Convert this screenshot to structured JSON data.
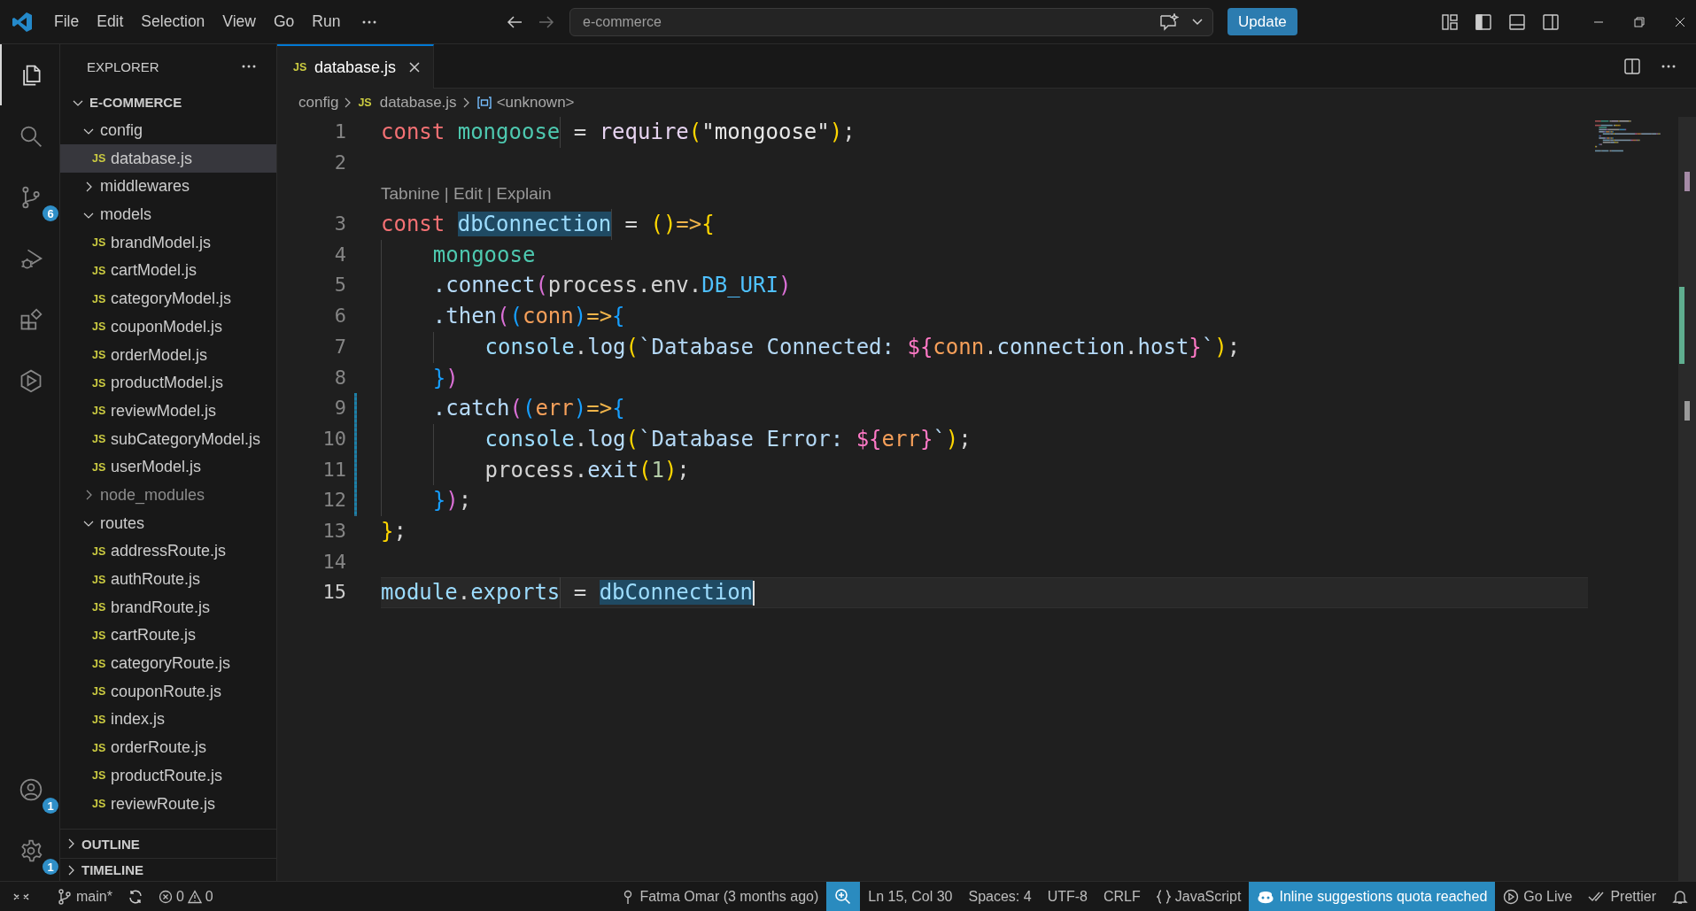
{
  "title_bar": {
    "menu": [
      "File",
      "Edit",
      "Selection",
      "View",
      "Go",
      "Run"
    ],
    "command_center": "e-commerce",
    "update_button": "Update"
  },
  "activity_bar": {
    "top": [
      {
        "kind": "files",
        "selected": true
      },
      {
        "kind": "search",
        "selected": false
      },
      {
        "kind": "source-control",
        "selected": false,
        "badge": "6"
      },
      {
        "kind": "run-debug",
        "selected": false
      },
      {
        "kind": "extensions",
        "selected": false
      },
      {
        "kind": "hexagon",
        "selected": false
      }
    ],
    "bottom": [
      {
        "kind": "accounts",
        "selected": false,
        "badge": "1"
      },
      {
        "kind": "settings",
        "selected": false,
        "badge": "1"
      }
    ]
  },
  "explorer": {
    "title": "EXPLORER",
    "tree": [
      {
        "name": "E-COMMERCE",
        "kind": "root",
        "expanded": true,
        "selected": false,
        "ignored": false,
        "children": [
          {
            "name": "config",
            "kind": "folder",
            "expanded": true,
            "selected": false,
            "ignored": false,
            "children": [
              {
                "name": "database.js",
                "kind": "file",
                "icon": "JS",
                "selected": true,
                "ignored": false
              }
            ]
          },
          {
            "name": "middlewares",
            "kind": "folder",
            "expanded": false,
            "selected": false,
            "ignored": false
          },
          {
            "name": "models",
            "kind": "folder",
            "expanded": true,
            "selected": false,
            "ignored": false,
            "children": [
              {
                "name": "brandModel.js",
                "kind": "file",
                "icon": "JS",
                "selected": false,
                "ignored": false
              },
              {
                "name": "cartModel.js",
                "kind": "file",
                "icon": "JS",
                "selected": false,
                "ignored": false
              },
              {
                "name": "categoryModel.js",
                "kind": "file",
                "icon": "JS",
                "selected": false,
                "ignored": false
              },
              {
                "name": "couponModel.js",
                "kind": "file",
                "icon": "JS",
                "selected": false,
                "ignored": false
              },
              {
                "name": "orderModel.js",
                "kind": "file",
                "icon": "JS",
                "selected": false,
                "ignored": false
              },
              {
                "name": "productModel.js",
                "kind": "file",
                "icon": "JS",
                "selected": false,
                "ignored": false
              },
              {
                "name": "reviewModel.js",
                "kind": "file",
                "icon": "JS",
                "selected": false,
                "ignored": false
              },
              {
                "name": "subCategoryModel.js",
                "kind": "file",
                "icon": "JS",
                "selected": false,
                "ignored": false
              },
              {
                "name": "userModel.js",
                "kind": "file",
                "icon": "JS",
                "selected": false,
                "ignored": false
              }
            ]
          },
          {
            "name": "node_modules",
            "kind": "folder",
            "expanded": false,
            "selected": false,
            "ignored": true
          },
          {
            "name": "routes",
            "kind": "folder",
            "expanded": true,
            "selected": false,
            "ignored": false,
            "children": [
              {
                "name": "addressRoute.js",
                "kind": "file",
                "icon": "JS",
                "selected": false,
                "ignored": false
              },
              {
                "name": "authRoute.js",
                "kind": "file",
                "icon": "JS",
                "selected": false,
                "ignored": false
              },
              {
                "name": "brandRoute.js",
                "kind": "file",
                "icon": "JS",
                "selected": false,
                "ignored": false
              },
              {
                "name": "cartRoute.js",
                "kind": "file",
                "icon": "JS",
                "selected": false,
                "ignored": false
              },
              {
                "name": "categoryRoute.js",
                "kind": "file",
                "icon": "JS",
                "selected": false,
                "ignored": false
              },
              {
                "name": "couponRoute.js",
                "kind": "file",
                "icon": "JS",
                "selected": false,
                "ignored": false
              },
              {
                "name": "index.js",
                "kind": "file",
                "icon": "JS",
                "selected": false,
                "ignored": false
              },
              {
                "name": "orderRoute.js",
                "kind": "file",
                "icon": "JS",
                "selected": false,
                "ignored": false
              },
              {
                "name": "productRoute.js",
                "kind": "file",
                "icon": "JS",
                "selected": false,
                "ignored": false
              },
              {
                "name": "reviewRoute.js",
                "kind": "file",
                "icon": "JS",
                "selected": false,
                "ignored": false
              }
            ]
          }
        ]
      }
    ],
    "sections": [
      {
        "label": "OUTLINE",
        "expanded": false
      },
      {
        "label": "TIMELINE",
        "expanded": false
      }
    ]
  },
  "tabs": [
    {
      "label": "database.js",
      "icon": "JS",
      "selected": true
    }
  ],
  "breadcrumbs": [
    {
      "label": "config",
      "kind": "folder"
    },
    {
      "label": "database.js",
      "kind": "file",
      "icon": "JS"
    },
    {
      "label": "<unknown>",
      "kind": "symbol"
    }
  ],
  "lines": [
    {
      "number": "1",
      "current": false,
      "changed": false,
      "tokens": [
        {
          "text": "const ",
          "kind": "kw"
        },
        {
          "text": "mongoose",
          "kind": "green"
        },
        {
          "text": " = ",
          "kind": "plain"
        },
        {
          "text": "require",
          "kind": "func"
        },
        {
          "text": "(",
          "kind": "b1"
        },
        {
          "text": "\"mongoose\"",
          "kind": "str"
        },
        {
          "text": ")",
          "kind": "b1"
        },
        {
          "text": ";",
          "kind": "plain"
        }
      ]
    },
    {
      "number": "2",
      "current": false,
      "changed": false
    },
    {
      "number": "3",
      "current": false,
      "changed": false,
      "lens": "Tabnine | Edit | Explain",
      "tokens": [
        {
          "text": "const ",
          "kind": "kw"
        },
        {
          "text": "dbConnection",
          "kind": "match"
        },
        {
          "text": " = ",
          "kind": "plain"
        },
        {
          "text": "()",
          "kind": "b1"
        },
        {
          "text": "=>",
          "kind": "op"
        },
        {
          "text": "{",
          "kind": "b1"
        }
      ]
    },
    {
      "number": "4",
      "current": false,
      "changed": false,
      "tokens": [
        {
          "text": "    mongoose",
          "kind": "green"
        }
      ]
    },
    {
      "number": "5",
      "current": false,
      "changed": false,
      "tokens": [
        {
          "text": "    .connect",
          "kind": "prop"
        },
        {
          "text": "(",
          "kind": "b2"
        },
        {
          "text": "process.env.",
          "kind": "plain"
        },
        {
          "text": "DB_URI",
          "kind": "const"
        },
        {
          "text": ")",
          "kind": "b2"
        }
      ]
    },
    {
      "number": "6",
      "current": false,
      "changed": false,
      "tokens": [
        {
          "text": "    .then",
          "kind": "prop"
        },
        {
          "text": "(",
          "kind": "b2"
        },
        {
          "text": "(",
          "kind": "b3"
        },
        {
          "text": "conn",
          "kind": "param"
        },
        {
          "text": ")",
          "kind": "b3"
        },
        {
          "text": "=>",
          "kind": "op"
        },
        {
          "text": "{",
          "kind": "b3"
        }
      ]
    },
    {
      "number": "7",
      "current": false,
      "changed": false,
      "tokens": [
        {
          "text": "        console",
          "kind": "var"
        },
        {
          "text": ".",
          "kind": "plain"
        },
        {
          "text": "log",
          "kind": "prop"
        },
        {
          "text": "(",
          "kind": "b1"
        },
        {
          "text": "`Database Connected: ",
          "kind": "tmpl"
        },
        {
          "text": "${",
          "kind": "interp"
        },
        {
          "text": "conn",
          "kind": "param"
        },
        {
          "text": ".",
          "kind": "plain"
        },
        {
          "text": "connection",
          "kind": "prop"
        },
        {
          "text": ".",
          "kind": "plain"
        },
        {
          "text": "host",
          "kind": "prop"
        },
        {
          "text": "}",
          "kind": "interp"
        },
        {
          "text": "`",
          "kind": "tmpl"
        },
        {
          "text": ")",
          "kind": "b1"
        },
        {
          "text": ";",
          "kind": "plain"
        }
      ]
    },
    {
      "number": "8",
      "current": false,
      "changed": false,
      "tokens": [
        {
          "text": "    }",
          "kind": "b3"
        },
        {
          "text": ")",
          "kind": "b2"
        }
      ]
    },
    {
      "number": "9",
      "current": false,
      "changed": true,
      "tokens": [
        {
          "text": "    .catch",
          "kind": "prop"
        },
        {
          "text": "(",
          "kind": "b2"
        },
        {
          "text": "(",
          "kind": "b3"
        },
        {
          "text": "err",
          "kind": "param"
        },
        {
          "text": ")",
          "kind": "b3"
        },
        {
          "text": "=>",
          "kind": "op"
        },
        {
          "text": "{",
          "kind": "b3"
        }
      ]
    },
    {
      "number": "10",
      "current": false,
      "changed": true,
      "tokens": [
        {
          "text": "        console",
          "kind": "var"
        },
        {
          "text": ".",
          "kind": "plain"
        },
        {
          "text": "log",
          "kind": "prop"
        },
        {
          "text": "(",
          "kind": "b1"
        },
        {
          "text": "`Database Error: ",
          "kind": "tmpl"
        },
        {
          "text": "${",
          "kind": "interp"
        },
        {
          "text": "err",
          "kind": "param"
        },
        {
          "text": "}",
          "kind": "interp"
        },
        {
          "text": "`",
          "kind": "tmpl"
        },
        {
          "text": ")",
          "kind": "b1"
        },
        {
          "text": ";",
          "kind": "plain"
        }
      ]
    },
    {
      "number": "11",
      "current": false,
      "changed": true,
      "tokens": [
        {
          "text": "        process.",
          "kind": "plain"
        },
        {
          "text": "exit",
          "kind": "prop"
        },
        {
          "text": "(",
          "kind": "b1"
        },
        {
          "text": "1",
          "kind": "num"
        },
        {
          "text": ")",
          "kind": "b1"
        },
        {
          "text": ";",
          "kind": "plain"
        }
      ]
    },
    {
      "number": "12",
      "current": false,
      "changed": true,
      "tokens": [
        {
          "text": "    }",
          "kind": "b3"
        },
        {
          "text": ")",
          "kind": "b2"
        },
        {
          "text": ";",
          "kind": "plain"
        }
      ]
    },
    {
      "number": "13",
      "current": false,
      "changed": false,
      "tokens": [
        {
          "text": "}",
          "kind": "b1"
        },
        {
          "text": ";",
          "kind": "plain"
        }
      ]
    },
    {
      "number": "14",
      "current": false,
      "changed": false
    },
    {
      "number": "15",
      "current": true,
      "changed": false,
      "tokens": [
        {
          "text": "module",
          "kind": "var"
        },
        {
          "text": ".",
          "kind": "plain"
        },
        {
          "text": "exports",
          "kind": "var"
        },
        {
          "text": " = ",
          "kind": "plain"
        },
        {
          "text": "dbConnection",
          "kind": "match"
        }
      ]
    }
  ],
  "status_bar": {
    "branch": "main*",
    "errors": "0",
    "warnings": "0",
    "right": [
      {
        "kind": "blame",
        "text": "Fatma Omar (3 months ago)",
        "highlighted": false
      },
      {
        "kind": "zoom",
        "highlighted": true
      },
      {
        "kind": "text",
        "text": "Ln 15, Col 30",
        "highlighted": false
      },
      {
        "kind": "text",
        "text": "Spaces: 4",
        "highlighted": false
      },
      {
        "kind": "text",
        "text": "UTF-8",
        "highlighted": false
      },
      {
        "kind": "text",
        "text": "CRLF",
        "highlighted": false
      },
      {
        "kind": "language",
        "text": "JavaScript",
        "highlighted": false
      },
      {
        "kind": "suggestions",
        "text": "Inline suggestions quota reached",
        "highlighted": true
      },
      {
        "kind": "golive",
        "text": "Go Live",
        "highlighted": false
      },
      {
        "kind": "prettier",
        "text": "Prettier",
        "highlighted": false
      },
      {
        "kind": "bell",
        "highlighted": false
      }
    ]
  }
}
